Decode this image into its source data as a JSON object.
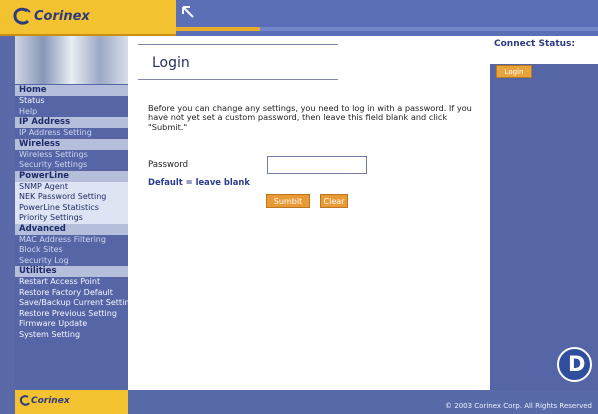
{
  "brand": {
    "name": "Corinex"
  },
  "sidebar": {
    "sections": [
      {
        "title": "Home",
        "items": [
          "Status",
          "Help"
        ]
      },
      {
        "title": "IP Address",
        "items": [
          "IP Address Setting"
        ]
      },
      {
        "title": "Wireless",
        "items": [
          "Wireless Settings",
          "Security Settings"
        ]
      },
      {
        "title": "PowerLine",
        "items": [
          "SNMP Agent",
          "NEK Password Setting",
          "PowerLine Statistics",
          "Priority Settings"
        ]
      },
      {
        "title": "Advanced",
        "items": [
          "MAC Address Filtering",
          "Block Sites",
          "Security Log"
        ]
      },
      {
        "title": "Utilities",
        "items": [
          "Restart Access Point",
          "Restore Factory Default",
          "Save/Backup Current Setting",
          "Restore Previous Setting",
          "Firmware Update",
          "System Setting"
        ]
      }
    ]
  },
  "main": {
    "title": "Login",
    "instructions": "Before you can change any settings, you need to log in with a password. If you have not yet set a custom password, then leave this field blank and click \"Submit.\"",
    "password_label": "Password",
    "default_note": "Default = leave blank",
    "submit_label": "Sumbit",
    "clear_label": "Clear"
  },
  "right": {
    "title": "Connect Status:",
    "login_chip": "Login"
  },
  "footer": {
    "brand": "Corinex",
    "copyright": "© 2003 Corinex Corp. All Rights Reserved"
  },
  "badge": {
    "letter": "D"
  },
  "topbar": {
    "progress": 0.2
  },
  "colors": {
    "gold": "#f3c230",
    "blue": "#5665a6",
    "orange": "#ea9a35"
  }
}
